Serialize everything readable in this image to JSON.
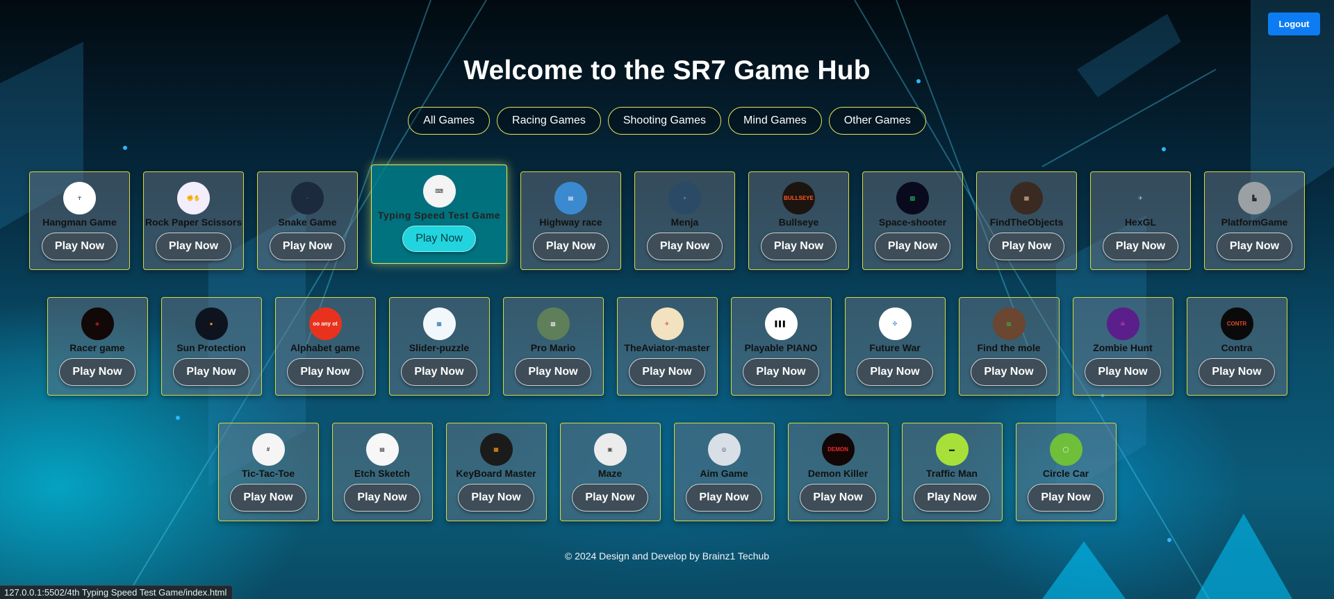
{
  "header": {
    "logout_label": "Logout",
    "title": "Welcome to the SR7 Game Hub"
  },
  "filters": [
    "All Games",
    "Racing Games",
    "Shooting Games",
    "Mind Games",
    "Other Games"
  ],
  "play_label": "Play Now",
  "rows": [
    [
      {
        "name": "Hangman Game",
        "icon": "hangman-icon",
        "bg": "#ffffff",
        "fg": "#000000",
        "glyph": "☥"
      },
      {
        "name": "Rock Paper Scissors",
        "icon": "rock-paper-scissors-icon",
        "bg": "#f2eefc",
        "fg": "#7a3fc9",
        "glyph": "✊✋"
      },
      {
        "name": "Snake Game",
        "icon": "snake-icon",
        "bg": "#1b2a3c",
        "fg": "#ff3355",
        "glyph": "·"
      },
      {
        "name": "Typing Speed Test Game",
        "icon": "typing-speed-icon",
        "bg": "#f4f4f4",
        "fg": "#333333",
        "glyph": "⌨",
        "hover": true
      },
      {
        "name": "Highway race",
        "icon": "highway-race-icon",
        "bg": "#3b8ad0",
        "fg": "#ffffff",
        "glyph": "▤"
      },
      {
        "name": "Menja",
        "icon": "menja-icon",
        "bg": "#2a4a66",
        "fg": "#dfe8f0",
        "glyph": "▫"
      },
      {
        "name": "Bullseye",
        "icon": "bullseye-icon",
        "bg": "#1c1410",
        "fg": "#ff5a1f",
        "glyph": "BULLSEYE"
      },
      {
        "name": "Space-shooter",
        "icon": "space-shooter-icon",
        "bg": "#0a0a1e",
        "fg": "#27ff7a",
        "glyph": "▥"
      },
      {
        "name": "FindTheObjects",
        "icon": "find-objects-icon",
        "bg": "#3a2a22",
        "fg": "#d8b890",
        "glyph": "▦"
      },
      {
        "name": "HexGL",
        "icon": "hexgl-icon",
        "bg": "rgba(0,0,0,0)",
        "fg": "#8fd8ff",
        "glyph": "✈"
      },
      {
        "name": "PlatformGame",
        "icon": "platform-game-icon",
        "bg": "#9aa0a4",
        "fg": "#2a2a2a",
        "glyph": "▙"
      }
    ],
    [
      {
        "name": "Racer game",
        "icon": "racer-game-icon",
        "bg": "#120808",
        "fg": "#d02020",
        "glyph": "◈"
      },
      {
        "name": "Sun Protection",
        "icon": "sun-protection-icon",
        "bg": "#0d1420",
        "fg": "#ff8a1a",
        "glyph": "●"
      },
      {
        "name": "Alphabet game",
        "icon": "alphabet-game-icon",
        "bg": "#e8321e",
        "fg": "#ffffff",
        "glyph": "oo any ot"
      },
      {
        "name": "Slider-puzzle",
        "icon": "slider-puzzle-icon",
        "bg": "#f2f7fb",
        "fg": "#1e6fb0",
        "glyph": "▦"
      },
      {
        "name": "Pro Mario",
        "icon": "pro-mario-icon",
        "bg": "#5f7f5a",
        "fg": "#e6e6e6",
        "glyph": "▩"
      },
      {
        "name": "TheAviator-master",
        "icon": "aviator-icon",
        "bg": "#f3e2bf",
        "fg": "#d33b2a",
        "glyph": "✈"
      },
      {
        "name": "Playable PIANO",
        "icon": "piano-icon",
        "bg": "#ffffff",
        "fg": "#000000",
        "glyph": "▌▌▌"
      },
      {
        "name": "Future War",
        "icon": "future-war-icon",
        "bg": "#ffffff",
        "fg": "#2b6cb8",
        "glyph": "✣"
      },
      {
        "name": "Find the mole",
        "icon": "find-mole-icon",
        "bg": "#6b4630",
        "fg": "#3ca043",
        "glyph": "▦"
      },
      {
        "name": "Zombie Hunt",
        "icon": "zombie-hunt-icon",
        "bg": "#5a1f8a",
        "fg": "#ff4fd0",
        "glyph": "☠"
      },
      {
        "name": "Contra",
        "icon": "contra-icon",
        "bg": "#0a0a0a",
        "fg": "#e24a2a",
        "glyph": "CONTR"
      }
    ],
    [
      {
        "name": "Tic-Tac-Toe",
        "icon": "tic-tac-toe-icon",
        "bg": "#f5f5f5",
        "fg": "#333333",
        "glyph": "#"
      },
      {
        "name": "Etch Sketch",
        "icon": "etch-sketch-icon",
        "bg": "#f7f7f7",
        "fg": "#1a1a1a",
        "glyph": "▤"
      },
      {
        "name": "KeyBoard Master",
        "icon": "keyboard-master-icon",
        "bg": "#1b1b1b",
        "fg": "#ff9a1a",
        "glyph": "▦"
      },
      {
        "name": "Maze",
        "icon": "maze-icon",
        "bg": "#ececec",
        "fg": "#555555",
        "glyph": "▣"
      },
      {
        "name": "Aim Game",
        "icon": "aim-game-icon",
        "bg": "#d9dfe6",
        "fg": "#4a5a6a",
        "glyph": "◎"
      },
      {
        "name": "Demon Killer",
        "icon": "demon-killer-icon",
        "bg": "#120606",
        "fg": "#ee2a2a",
        "glyph": "DEMON"
      },
      {
        "name": "Traffic Man",
        "icon": "traffic-man-icon",
        "bg": "#a8e03a",
        "fg": "#1f2a1f",
        "glyph": "▬"
      },
      {
        "name": "Circle Car",
        "icon": "circle-car-icon",
        "bg": "#6fbf3a",
        "fg": "#ffffff",
        "glyph": "◯"
      }
    ]
  ],
  "footer": "© 2024 Design and Develop by Brainz1 Techub",
  "status_url": "127.0.0.1:5502/4th Typing Speed Test Game/index.html"
}
